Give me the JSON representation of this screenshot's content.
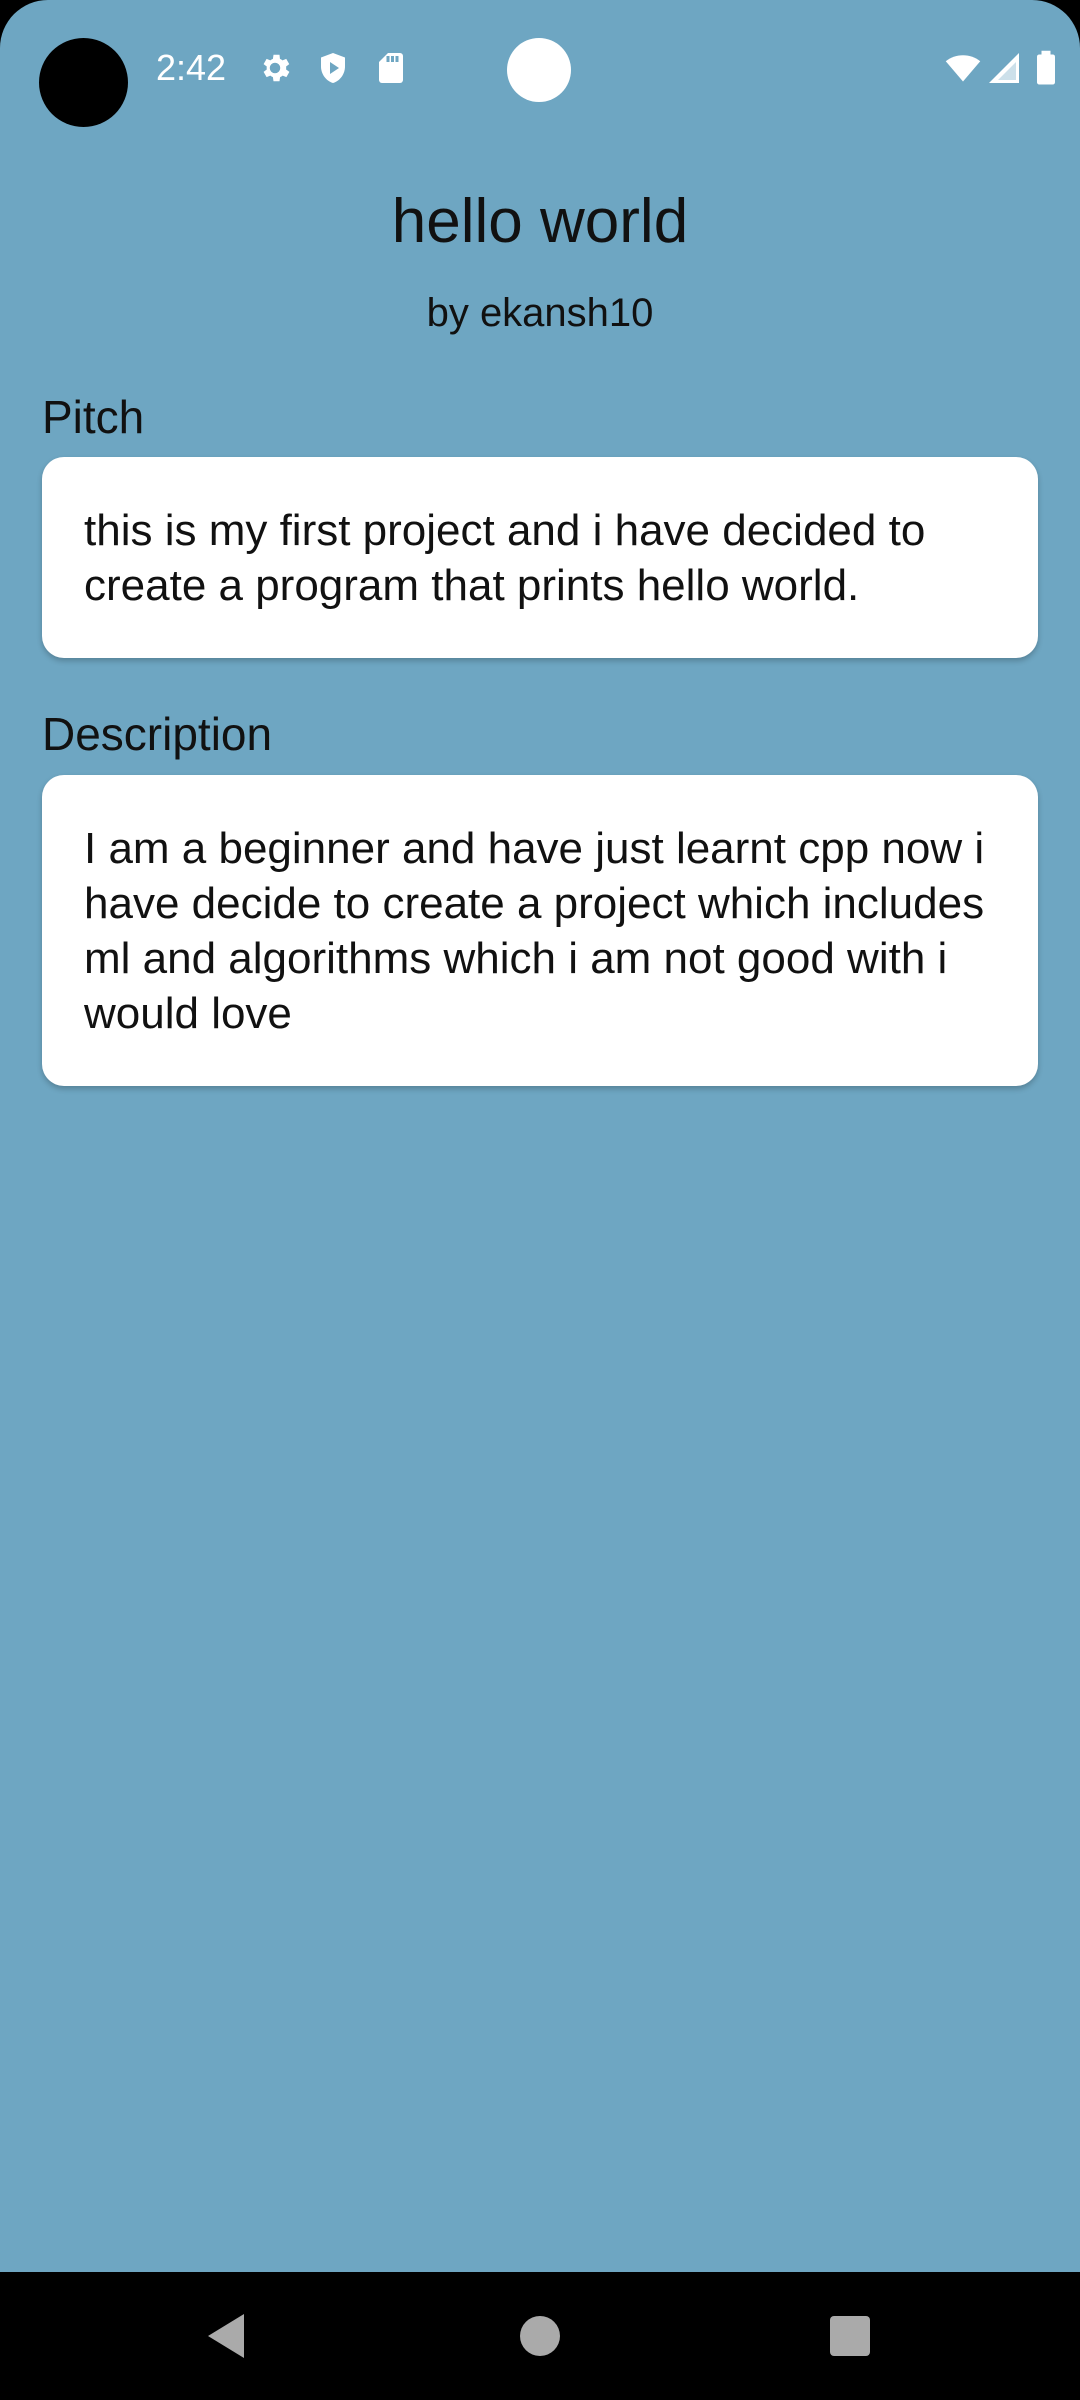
{
  "status_bar": {
    "time": "2:42",
    "left_icons": [
      "settings-icon",
      "shield-icon",
      "sd-card-icon"
    ],
    "right_icons": [
      "wifi-icon",
      "signal-icon",
      "battery-icon"
    ]
  },
  "header": {
    "title": "hello world",
    "subtitle": "by ekansh10"
  },
  "pitch": {
    "label": "Pitch",
    "text": "this is my first project and i have decided to create a program that prints hello world."
  },
  "description": {
    "label": "Description",
    "text": "I am a beginner and have just learnt cpp now i have decide to create a project which includes ml and algorithms which i am not good with i would love"
  },
  "nav": {
    "buttons": [
      "back-icon",
      "home-icon",
      "recents-icon"
    ]
  },
  "colors": {
    "background": "#6ea6c2",
    "card": "#ffffff",
    "text": "#111111"
  }
}
